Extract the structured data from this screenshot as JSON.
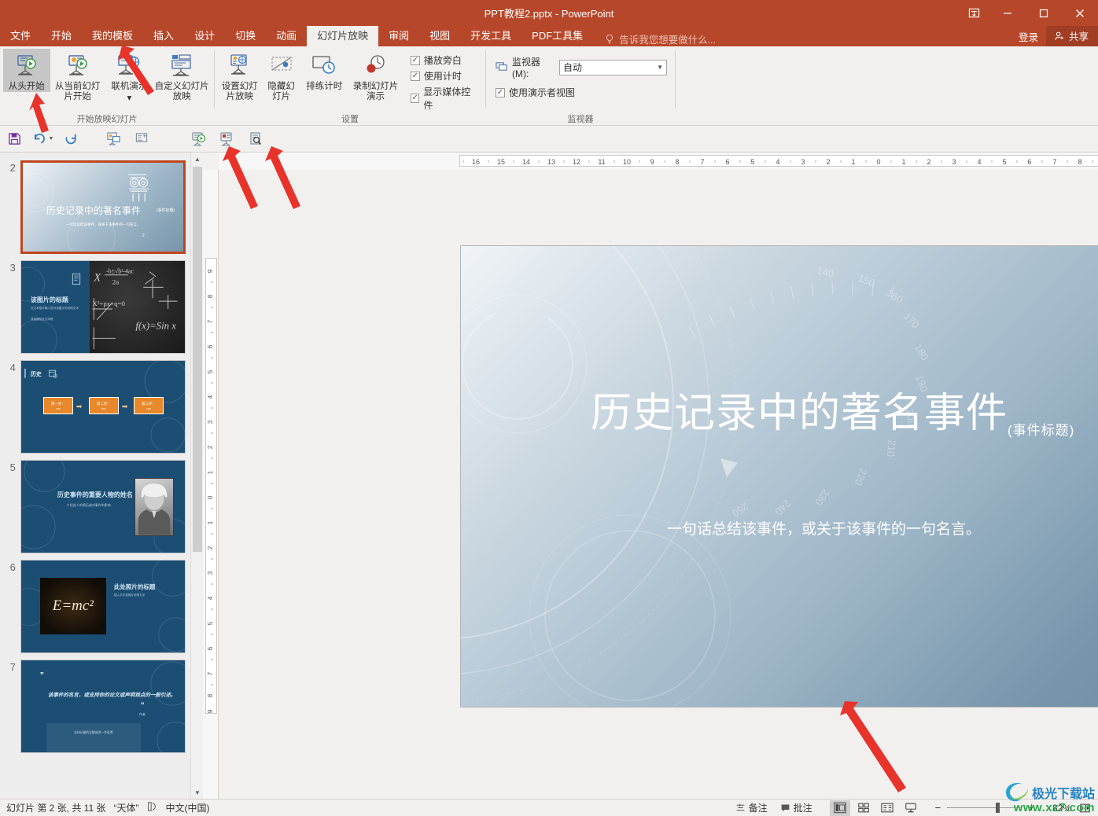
{
  "window": {
    "title": "PPT教程2.pptx - PowerPoint",
    "ribbon_display_icon": "ribbon-display-options-icon",
    "minimize": "–",
    "maximize": "▢",
    "close": "✕",
    "signin": "登录",
    "share": "共享"
  },
  "tabs": [
    {
      "label": "文件",
      "active": false
    },
    {
      "label": "开始",
      "active": false
    },
    {
      "label": "我的模板",
      "active": false
    },
    {
      "label": "插入",
      "active": false
    },
    {
      "label": "设计",
      "active": false
    },
    {
      "label": "切换",
      "active": false
    },
    {
      "label": "动画",
      "active": false
    },
    {
      "label": "幻灯片放映",
      "active": true
    },
    {
      "label": "审阅",
      "active": false
    },
    {
      "label": "视图",
      "active": false
    },
    {
      "label": "开发工具",
      "active": false
    },
    {
      "label": "PDF工具集",
      "active": false
    }
  ],
  "tellme": {
    "placeholder": "告诉我您想要做什么...",
    "icon": "lightbulb-icon"
  },
  "ribbon": {
    "groups": [
      {
        "label": "开始放映幻灯片",
        "buttons": [
          {
            "label": "从头开始",
            "icon": "start-from-beginning-icon",
            "selected": true
          },
          {
            "label": "从当前幻灯片开始",
            "icon": "start-from-current-icon",
            "selected": false
          },
          {
            "label": "联机演示",
            "icon": "present-online-icon",
            "selected": false,
            "dropdown": true
          },
          {
            "label": "自定义幻灯片放映",
            "icon": "custom-slideshow-icon",
            "selected": false,
            "dropdown": true
          }
        ]
      },
      {
        "label": "设置",
        "buttons": [
          {
            "label": "设置幻灯片放映",
            "icon": "setup-slideshow-icon",
            "selected": false
          },
          {
            "label": "隐藏幻灯片",
            "icon": "hide-slide-icon",
            "selected": false
          },
          {
            "label": "排练计时",
            "icon": "rehearse-timings-icon",
            "selected": false
          },
          {
            "label": "录制幻灯片演示",
            "icon": "record-slideshow-icon",
            "selected": false,
            "dropdown": true
          }
        ],
        "checkboxes": [
          {
            "label": "播放旁白",
            "checked": true
          },
          {
            "label": "使用计时",
            "checked": true
          },
          {
            "label": "显示媒体控件",
            "checked": true
          }
        ]
      },
      {
        "label": "监视器",
        "monitor_label": "监视器(M):",
        "monitor_value": "自动",
        "monitor_icon": "monitor-icon",
        "presenter_view": {
          "label": "使用演示者视图",
          "checked": true
        }
      }
    ]
  },
  "quick_access": [
    {
      "icon": "save-icon",
      "name": "save"
    },
    {
      "icon": "undo-icon",
      "name": "undo",
      "dropdown": true
    },
    {
      "icon": "redo-icon",
      "name": "redo"
    },
    {
      "icon": "start-presentation-icon",
      "name": "from-beginning-qat"
    },
    {
      "icon": "new-slide-icon",
      "name": "new-slide-qat"
    },
    {
      "icon": "slideshow-play-icon",
      "name": "play-qat"
    },
    {
      "icon": "present-icon",
      "name": "present-qat"
    },
    {
      "icon": "preview-icon",
      "name": "print-preview-qat"
    }
  ],
  "rulers": {
    "horizontal": [
      "16",
      "15",
      "14",
      "13",
      "12",
      "11",
      "10",
      "9",
      "8",
      "7",
      "6",
      "5",
      "4",
      "3",
      "2",
      "1",
      "0",
      "1",
      "2",
      "3",
      "4",
      "5",
      "6",
      "7",
      "8",
      "9",
      "10",
      "11",
      "12",
      "13",
      "14",
      "15",
      "16"
    ],
    "vertical": [
      "9",
      "8",
      "7",
      "6",
      "5",
      "4",
      "3",
      "2",
      "1",
      "0",
      "1",
      "2",
      "3",
      "4",
      "5",
      "6",
      "7",
      "8",
      "9"
    ]
  },
  "thumbnails": [
    {
      "number": "2",
      "selected": true,
      "kind": "title",
      "title": "历史记录中的著名事件",
      "title_sub": "(事件标题)",
      "subtitle": "一句话总结该事件，或关于该事件的一句名言。",
      "page": "2"
    },
    {
      "number": "3",
      "selected": false,
      "kind": "picture-left",
      "title": "该图片的标题",
      "body1": "在文本框中输入您对该图片的说明文字",
      "body2": "或者删除此文本框"
    },
    {
      "number": "4",
      "selected": false,
      "kind": "steps",
      "title": "历史",
      "steps": [
        "第一步：",
        "第二步：",
        "第三步："
      ],
      "step_sub": "xxx"
    },
    {
      "number": "5",
      "selected": false,
      "kind": "person",
      "title": "历史事件的重要人物的姓名",
      "subtitle": "介绍此人的简历或对事件的影响"
    },
    {
      "number": "6",
      "selected": false,
      "kind": "photo-left",
      "title": "此处照片的标题",
      "body": "插入文字或照片说明文字"
    },
    {
      "number": "7",
      "selected": false,
      "kind": "quote",
      "quote": "该事件的名言，或支持你的论文或声明观点的一般引述。",
      "author": "作者",
      "note": "支持论据的注解或进一步说明"
    }
  ],
  "slide": {
    "title": "历史记录中的著名事件",
    "title_suffix": "(事件标题)",
    "subtitle": "一句话总结该事件，或关于该事件的一句名言。",
    "page_number": "2",
    "decor_icon": "ionic-column-icon",
    "dial_labels": [
      "140",
      "150",
      "160",
      "170",
      "180",
      "190",
      "200",
      "210",
      "220",
      "230",
      "240",
      "250"
    ]
  },
  "statusbar": {
    "slide_info": "幻灯片 第 2 张, 共 11 张",
    "theme": "“天体”",
    "accessibility_icon": "accessibility-icon",
    "language": "中文(中国)",
    "notes": "备注",
    "comments": "批注",
    "notes_icon": "notes-icon",
    "comments_icon": "comment-icon",
    "views": [
      {
        "name": "normal-view",
        "icon": "normal-view-icon",
        "active": true
      },
      {
        "name": "slide-sorter-view",
        "icon": "slide-sorter-icon",
        "active": false
      },
      {
        "name": "reading-view",
        "icon": "reading-view-icon",
        "active": false
      },
      {
        "name": "slideshow-view",
        "icon": "slideshow-icon",
        "active": false
      }
    ],
    "zoom_out": "−",
    "zoom_in": "+",
    "zoom_level": "82%",
    "fit_icon": "fit-to-window-icon"
  },
  "watermark": {
    "brand": "极光下载站",
    "url": "www.xz7.com"
  },
  "colors": {
    "accent": "#b7472a",
    "ribbon_bg": "#f2f0ef",
    "selection": "#c0451f",
    "arrow": "#e8332a"
  }
}
